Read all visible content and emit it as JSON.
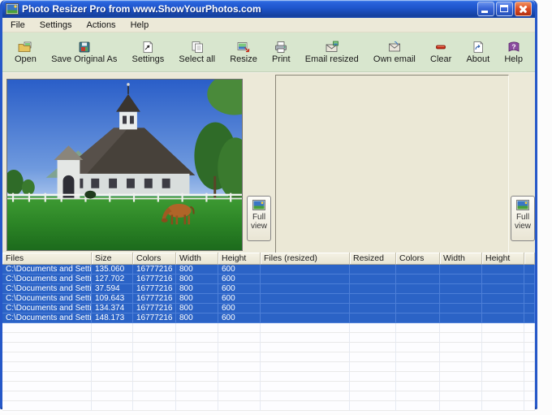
{
  "window": {
    "title": "Photo Resizer Pro from www.ShowYourPhotos.com"
  },
  "menu": {
    "items": [
      {
        "label": "File"
      },
      {
        "label": "Settings"
      },
      {
        "label": "Actions"
      },
      {
        "label": "Help"
      }
    ]
  },
  "toolbar": {
    "buttons": [
      {
        "label": "Open",
        "icon": "open-folder-icon"
      },
      {
        "label": "Save Original As",
        "icon": "save-icon"
      },
      {
        "label": "Settings",
        "icon": "settings-page-icon"
      },
      {
        "label": "Select all",
        "icon": "select-all-icon"
      },
      {
        "label": "Resize",
        "icon": "resize-image-icon"
      },
      {
        "label": "Print",
        "icon": "printer-icon"
      },
      {
        "label": "Email resized",
        "icon": "email-resized-icon"
      },
      {
        "label": "Own email",
        "icon": "own-email-icon"
      },
      {
        "label": "Clear",
        "icon": "clear-icon"
      },
      {
        "label": "About",
        "icon": "about-icon"
      },
      {
        "label": "Help",
        "icon": "help-book-icon"
      }
    ]
  },
  "preview": {
    "left_full_view": "Full view",
    "right_full_view": "Full view"
  },
  "table": {
    "columns": [
      "Files",
      "Size",
      "Colors",
      "Width",
      "Height",
      "Files (resized)",
      "Resized",
      "Colors",
      "Width",
      "Height"
    ],
    "rows": [
      {
        "file": "C:\\Documents and Setti...",
        "size": "135.060",
        "colors": "16777216",
        "width": "800",
        "height": "600",
        "file_resized": "",
        "resized": "",
        "colors2": "",
        "width2": "",
        "height2": ""
      },
      {
        "file": "C:\\Documents and Setti...",
        "size": "127.702",
        "colors": "16777216",
        "width": "800",
        "height": "600",
        "file_resized": "",
        "resized": "",
        "colors2": "",
        "width2": "",
        "height2": ""
      },
      {
        "file": "C:\\Documents and Setti...",
        "size": "37.594",
        "colors": "16777216",
        "width": "800",
        "height": "600",
        "file_resized": "",
        "resized": "",
        "colors2": "",
        "width2": "",
        "height2": ""
      },
      {
        "file": "C:\\Documents and Setti...",
        "size": "109.643",
        "colors": "16777216",
        "width": "800",
        "height": "600",
        "file_resized": "",
        "resized": "",
        "colors2": "",
        "width2": "",
        "height2": ""
      },
      {
        "file": "C:\\Documents and Setti...",
        "size": "134.374",
        "colors": "16777216",
        "width": "800",
        "height": "600",
        "file_resized": "",
        "resized": "",
        "colors2": "",
        "width2": "",
        "height2": ""
      },
      {
        "file": "C:\\Documents and Setti...",
        "size": "148.173",
        "colors": "16777216",
        "width": "800",
        "height": "600",
        "file_resized": "",
        "resized": "",
        "colors2": "",
        "width2": "",
        "height2": ""
      }
    ],
    "empty_row_count": 9
  },
  "colors": {
    "titlebar_blue": "#1e55cc",
    "window_border_blue": "#2658c8",
    "toolbar_green": "#d8e6ce",
    "panel_beige": "#ece9d8",
    "selection_blue": "#2b63c6"
  }
}
